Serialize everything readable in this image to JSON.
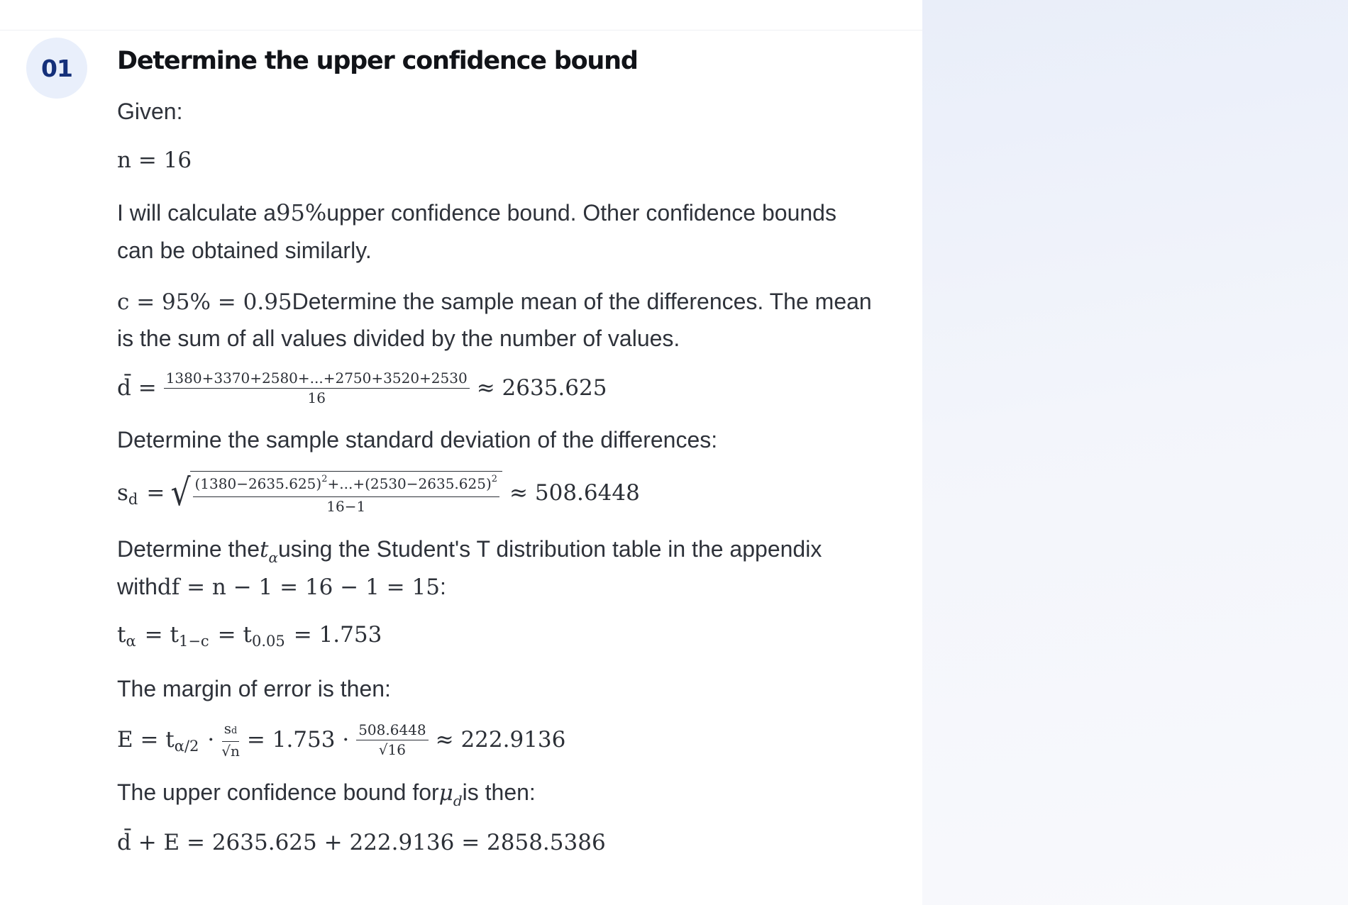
{
  "step": {
    "number": "01",
    "title": "Determine the upper confidence bound"
  },
  "text": {
    "given": "Given:",
    "n_eq": "n = 16",
    "calc_line1_a": "I will calculate a",
    "calc_line1_b": "95%",
    "calc_line1_c": "upper confidence bound. Other confidence bounds",
    "calc_line2": "can be obtained similarly.",
    "c_math": "c = 95% = 0.95",
    "mean_line1": "Determine the sample mean of the differences. The mean",
    "mean_line2": "is the sum of all values divided by the number of values.",
    "dbar_lhs": "d̄ =",
    "dbar_num": "1380+3370+2580+...+2750+3520+2530",
    "dbar_den": "16",
    "dbar_rhs": "≈ 2635.625",
    "sd_intro": "Determine the sample standard deviation of the differences:",
    "sd_lhs_s": "s",
    "sd_lhs_sub": "d",
    "sd_lhs_eq": "=",
    "sd_num_a": "(1380−2635.625)",
    "sd_num_b": "+...+(2530−2635.625)",
    "sd_num_sup": "2",
    "sd_den": "16−1",
    "sd_rhs": "≈ 508.6448",
    "t_line1_a": "Determine the",
    "t_line1_t": "t",
    "t_line1_sub": "α",
    "t_line1_b": "using the Student's T distribution table in the appendix",
    "t_line2_a": "with",
    "t_line2_math": "df = n − 1 = 16 − 1 = 15",
    "t_line2_b": ":",
    "t_eq_1": "t",
    "t_eq_1_sub": "α",
    "t_eq_2": "= t",
    "t_eq_2_sub": "1−c",
    "t_eq_3": "= t",
    "t_eq_3_sub": "0.05",
    "t_eq_4": "= 1.753",
    "margin_intro": "The margin of error is then:",
    "e_lhs": "E = t",
    "e_lhs_sub": "α/2",
    "e_dot": "·",
    "e_frac1_num": "s",
    "e_frac1_num_sub": "d",
    "e_frac1_den": "√n",
    "e_mid": "= 1.753 ·",
    "e_frac2_num": "508.6448",
    "e_frac2_den": "√16",
    "e_rhs": "≈ 222.9136",
    "upper_intro_a": "The upper confidence bound for",
    "upper_intro_mu": "μ",
    "upper_intro_sub": "d",
    "upper_intro_b": "is then:",
    "final_eq": "d̄ + E = 2635.625 + 222.9136 = 2858.5386"
  }
}
